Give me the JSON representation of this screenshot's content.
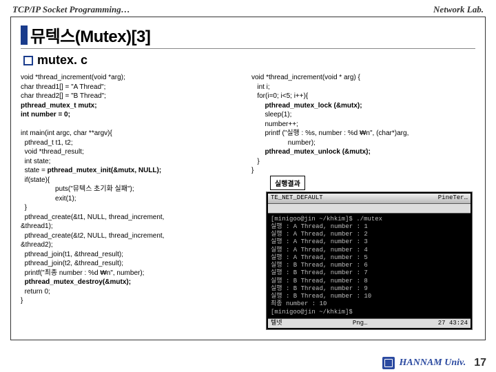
{
  "header": {
    "left": "TCP/IP Socket Programming…",
    "right": "Network Lab."
  },
  "title": "뮤텍스(Mutex)[3]",
  "subtitle": "mutex. c",
  "code_left": "void *thread_increment(void *arg);\nchar thread1[] = \"A Thread\";\nchar thread2[] = \"B Thread\";\npthread_mutex_t mutx;\nint number = 0;\n\nint main(int argc, char **argv){\n  pthread_t t1, t2;\n  void *thread_result;\n  int state;\n  state = pthread_mutex_init(&mutx, NULL);\n  if(state){\n                  puts(\"뮤텍스 초기화 실패\");\n                  exit(1);\n  }\n  pthread_create(&t1, NULL, thread_increment,\n&thread1);\n  pthread_create(&t2, NULL, thread_increment,\n&thread2);\n  pthread_join(t1, &thread_result);\n  pthread_join(t2, &thread_result);\n  printf(\"최종 number : %d ₩n\", number);\n  pthread_mutex_destroy(&mutx);\n  return 0;\n}",
  "code_right": "void *thread_increment(void * arg) {\n   int i;\n   for(i=0; i<5; i++){\n       pthread_mutex_lock (&mutx);\n       sleep(1);\n       number++;\n       printf (\"실행 : %s, number : %d ₩n\", (char*)arg,\n                   number);\n       pthread_mutex_unlock (&mutx);\n   }\n}",
  "result_label": "실행결과",
  "term_title": {
    "left": "TE_NET_DEFAULT",
    "right": "PineTer…"
  },
  "term_body": "[minigoo@jin ~/khkim]$ ./mutex\n실행 : A Thread, number : 1\n실행 : A Thread, number : 2\n실행 : A Thread, number : 3\n실행 : A Thread, number : 4\n실행 : A Thread, number : 5\n실행 : B Thread, number : 6\n실행 : B Thread, number : 7\n실행 : B Thread, number : 8\n실행 : B Thread, number : 9\n실행 : B Thread, number : 10\n최종 number : 10\n[minigoo@jin ~/khkim]$ ",
  "term_bottom": {
    "left": "텔넷",
    "mid": "Png…",
    "right": "27   43:24"
  },
  "footer": {
    "uni": "HANNAM Univ.",
    "page": "17"
  }
}
